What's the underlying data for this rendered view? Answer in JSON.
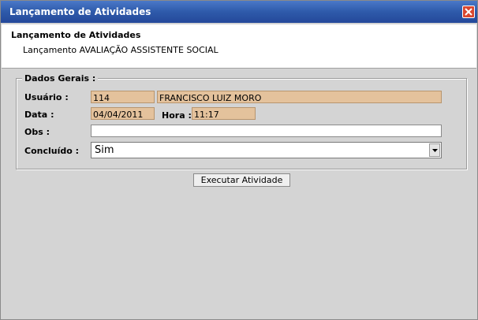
{
  "window": {
    "title": "Lançamento de Atividades",
    "close_icon": "close-icon"
  },
  "header": {
    "title": "Lançamento de Atividades",
    "subtitle": "Lançamento AVALIAÇÃO ASSISTENTE SOCIAL"
  },
  "form": {
    "legend": "Dados Gerais :",
    "usuario_label": "Usuário :",
    "usuario_id": "114",
    "usuario_name": "FRANCISCO LUIZ MORO",
    "data_label": "Data :",
    "data_value": "04/04/2011",
    "hora_label": "Hora :",
    "hora_value": "11:17",
    "obs_label": "Obs :",
    "obs_value": "",
    "concluido_label": "Concluído :",
    "concluido_value": "Sim",
    "dropdown_icon": "chevron-down-icon"
  },
  "actions": {
    "execute_label": "Executar Atividade"
  },
  "colors": {
    "titlebar": "#2e5aaa",
    "readonly_field": "#e4c29c",
    "background": "#d4d4d4"
  }
}
